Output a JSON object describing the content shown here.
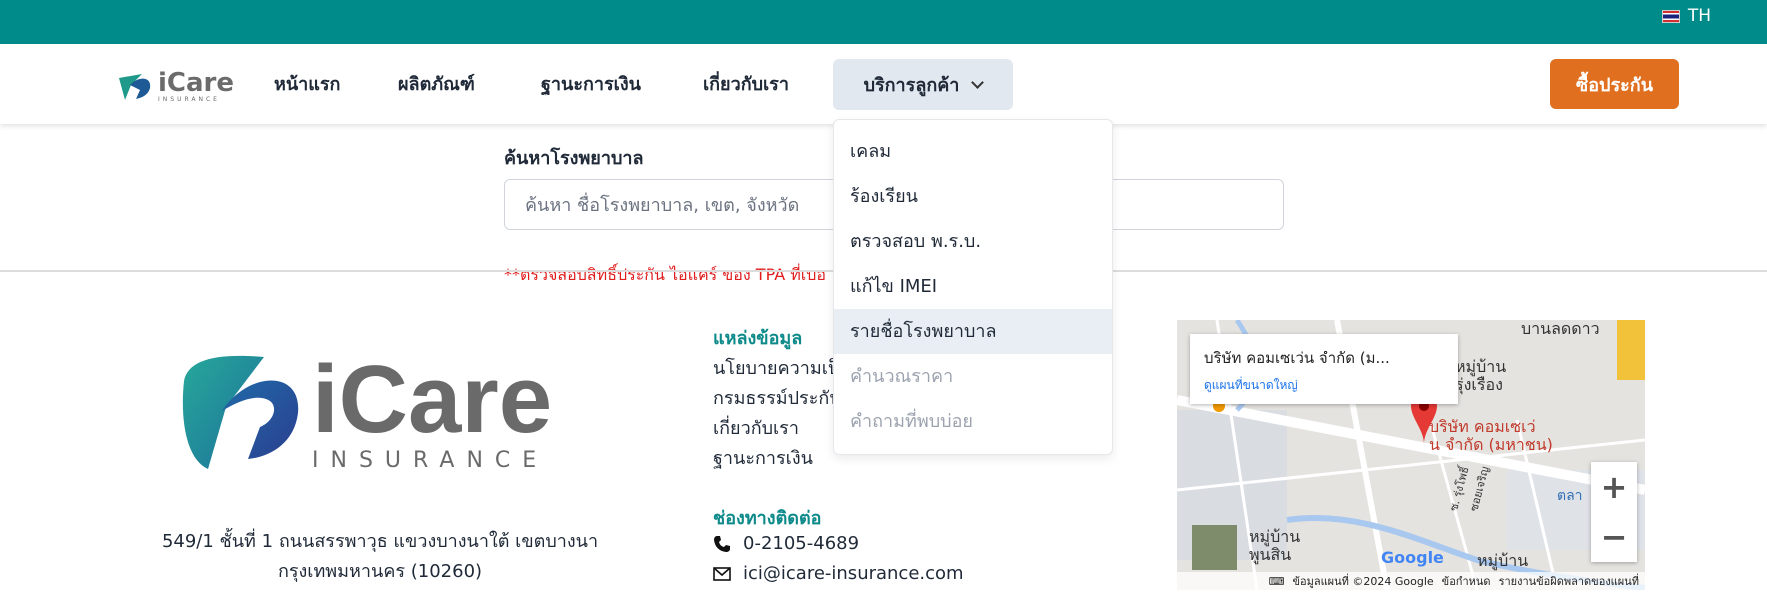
{
  "topbar": {
    "lang": "TH",
    "color": "#008b8b"
  },
  "brand": {
    "name": "iCare",
    "sub": "INSURANCE",
    "sub_small": "INSURANCE",
    "accent": "#0e8a8a"
  },
  "nav": {
    "home": "หน้าแรก",
    "products": "ผลิตภัณฑ์",
    "financial": "ฐานะการเงิน",
    "about": "เกี่ยวกับเรา",
    "service": "บริการลูกค้า",
    "buy": "ซื้อประกัน"
  },
  "dropdown": {
    "items": [
      {
        "label": "เคลม"
      },
      {
        "label": "ร้องเรียน"
      },
      {
        "label": "ตรวจสอบ พ.ร.บ."
      },
      {
        "label": "แก้ไข IMEI"
      },
      {
        "label": "รายชื่อโรงพยาบาล"
      },
      {
        "label": "คำนวณราคา"
      },
      {
        "label": "คำถามที่พบบ่อย"
      }
    ]
  },
  "search": {
    "title": "ค้นหาโรงพยาบาล",
    "placeholder": "ค้นหา ชื่อโรงพยาบาล, เขต, จังหวัด",
    "note": "**ตรวจสอบสิทธิ์ประกัน ไอแคร์ ของ TPA ที่เบอ"
  },
  "footer": {
    "address_line1": "549/1 ชั้นที่ 1 ถนนสรรพาวุธ แขวงบางนาใต้ เขตบางนา",
    "address_line2": "กรุงเทพมหานคร (10260)",
    "resources_title": "แหล่งข้อมูล",
    "resources": [
      "นโยบายความเป็",
      "กรมธรรม์ประกัน",
      "เกี่ยวกับเรา",
      "ฐานะการเงิน"
    ],
    "contact_title": "ช่องทางติดต่อ",
    "phone": "0-2105-4689",
    "email": "ici@icare-insurance.com"
  },
  "map": {
    "place": "บริษัท คอมเซเว่น จำกัด (ม...",
    "view_larger": "ดูแผนที่ขนาดใหญ่",
    "pin_label_1": "บริษัท คอมเซเว่",
    "pin_label_2": "น จำกัด (มหาชน)",
    "label_top": "บานลดดาว",
    "label_village_1": "หมู่บ้าน",
    "label_village_1b": "รุ่งเรือง",
    "label_village_2": "หมู่บ้าน",
    "label_village_2b": "พูนสิน",
    "label_village_3": "หมู่บ้าน",
    "label_soi": "ซ. รุ่งโพธิ์",
    "label_soi2": "ซอยเจริญ",
    "label_right": "ตลา",
    "google": "Google",
    "footer_data": "ข้อมูลแผนที่ ©2024 Google",
    "footer_terms": "ข้อกำหนด",
    "footer_report": "รายงานข้อผิดพลาดของแผนที่",
    "zoom_in": "+",
    "zoom_out": "−"
  }
}
